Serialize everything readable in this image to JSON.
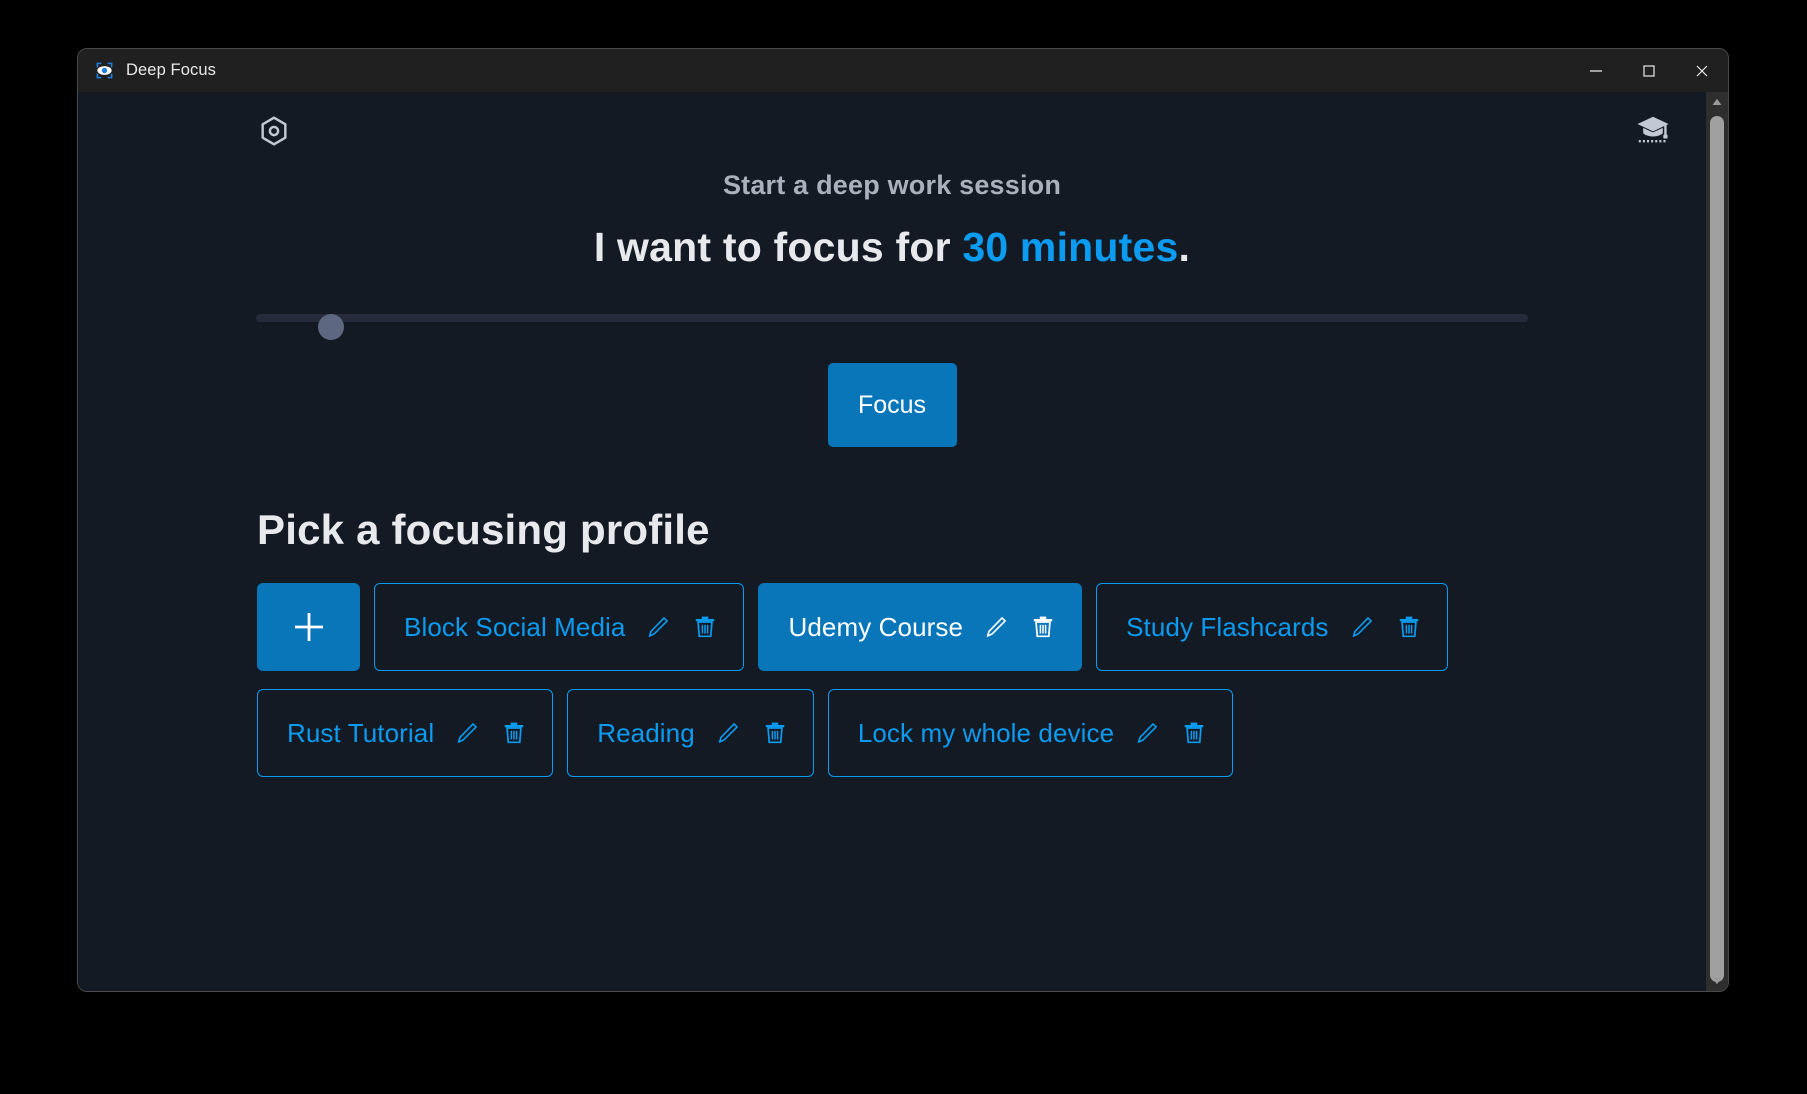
{
  "window": {
    "title": "Deep Focus",
    "app_icon": "eye-focus-icon",
    "controls": {
      "minimize": "minimize-icon",
      "maximize": "maximize-icon",
      "close": "close-icon"
    }
  },
  "header": {
    "settings_icon": "hexagon-settings-icon",
    "tutorial_icon": "graduation-cap-icon"
  },
  "main": {
    "subtitle": "Start a deep work session",
    "headline_prefix": "I want to focus for ",
    "headline_value": "30 minutes",
    "headline_suffix": ".",
    "duration_minutes": 30,
    "slider": {
      "value_percent": 5,
      "track_color": "#252b3a",
      "thumb_color": "#5d6780"
    },
    "focus_button_label": "Focus",
    "profiles_heading": "Pick a focusing profile",
    "add_profile_label": "+",
    "profiles": [
      {
        "label": "Block Social Media",
        "selected": false,
        "edit_icon": "pencil-icon",
        "delete_icon": "trash-icon"
      },
      {
        "label": "Udemy Course",
        "selected": true,
        "edit_icon": "pencil-icon",
        "delete_icon": "trash-icon"
      },
      {
        "label": "Study Flashcards",
        "selected": false,
        "edit_icon": "pencil-icon",
        "delete_icon": "trash-icon"
      },
      {
        "label": "Rust Tutorial",
        "selected": false,
        "edit_icon": "pencil-icon",
        "delete_icon": "trash-icon"
      },
      {
        "label": "Reading",
        "selected": false,
        "edit_icon": "pencil-icon",
        "delete_icon": "trash-icon"
      },
      {
        "label": "Lock my whole device",
        "selected": false,
        "edit_icon": "pencil-icon",
        "delete_icon": "trash-icon"
      }
    ]
  },
  "colors": {
    "accent": "#0b9bf0",
    "accent_fill": "#0a76ba",
    "background": "#141a24",
    "titlebar": "#202020",
    "text_primary": "#e7e9ed",
    "text_muted": "#aab0bc"
  }
}
